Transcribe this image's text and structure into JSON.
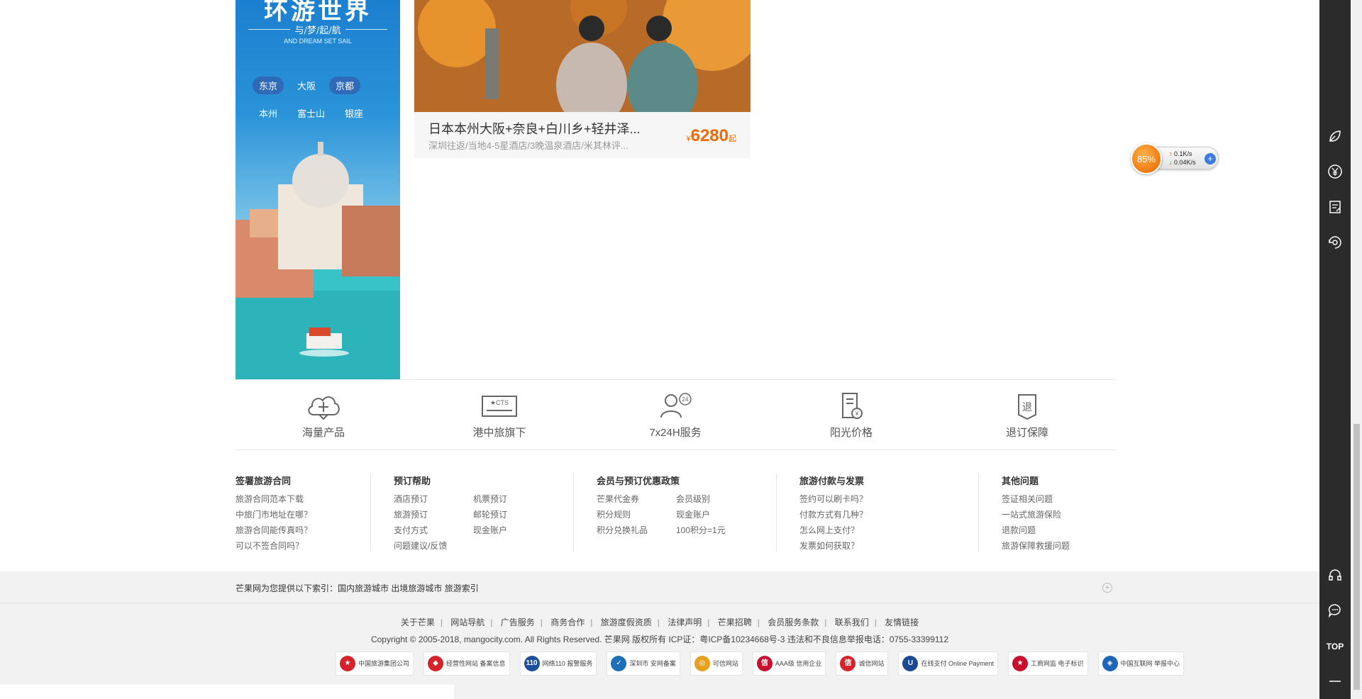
{
  "banner": {
    "title": "环游世界",
    "subtitle": "与/梦/起/航",
    "subtitle_en": "AND DREAM SET SAIL",
    "cities_row1": [
      "东京",
      "大阪",
      "京都"
    ],
    "cities_row2": [
      "本州",
      "富士山",
      "银座"
    ]
  },
  "product": {
    "title": "日本本州大阪+奈良+白川乡+轻井泽...",
    "desc": "深圳往返/当地4-5星酒店/3晚温泉酒店/米其林评...",
    "currency": "¥",
    "price": "6280",
    "price_suffix": "起"
  },
  "services": [
    {
      "label": "海量产品",
      "icon": "cloud-plus-icon"
    },
    {
      "label": "港中旅旗下",
      "icon": "cts-card-icon"
    },
    {
      "label": "7x24H服务",
      "icon": "user-24h-icon"
    },
    {
      "label": "阳光价格",
      "icon": "price-document-icon"
    },
    {
      "label": "退订保障",
      "icon": "refund-shield-icon"
    }
  ],
  "help": {
    "contract": {
      "title": "签署旅游合同",
      "links": [
        "旅游合同范本下载",
        "中旅门市地址在哪？",
        "旅游合同能传真吗？",
        "可以不签合同吗？"
      ]
    },
    "booking": {
      "title": "预订帮助",
      "links": [
        "酒店预订",
        "机票预订",
        "旅游预订",
        "邮轮预订",
        "支付方式",
        "现金账户",
        "问题建议/反馈"
      ]
    },
    "member": {
      "title": "会员与预订优惠政策",
      "links": [
        "芒果代金券",
        "会员级别",
        "积分规则",
        "现金账户",
        "积分兑换礼品",
        "100积分=1元"
      ]
    },
    "payment": {
      "title": "旅游付款与发票",
      "links": [
        "签约可以刷卡吗？",
        "付款方式有几种？",
        "怎么网上支付？",
        "发票如何获取？"
      ]
    },
    "other": {
      "title": "其他问题",
      "links": [
        "签证相关问题",
        "一站式旅游保险",
        "退款问题",
        "旅游保障救援问题"
      ]
    }
  },
  "index_bar": {
    "prefix": "芒果网为您提供以下索引：",
    "links": [
      "国内旅游城市",
      "出境旅游城市",
      "旅游索引"
    ]
  },
  "footer": {
    "links": [
      "关于芒果",
      "网站导航",
      "广告服务",
      "商务合作",
      "旅游度假资质",
      "法律声明",
      "芒果招聘",
      "会员服务条款",
      "联系我们",
      "友情链接"
    ],
    "copyright": "Copyright © 2005-2018, mangocity.com. All Rights Reserved. 芒果网 版权所有 ICP证：粤ICP备10234668号-3 违法和不良信息举报电话：0755-33399112",
    "badges": [
      {
        "text": "中国旅游集团公司",
        "color": "#d4232b"
      },
      {
        "text": "经营性网站 备案信息",
        "color": "#d4232b"
      },
      {
        "text": "网络110 报警服务",
        "color": "#1c4f9c"
      },
      {
        "text": "深圳市 安网备案",
        "color": "#1c6fb8"
      },
      {
        "text": "可信网站",
        "color": "#d4232b"
      },
      {
        "text": "AAA级 信用企业",
        "color": "#c8102e"
      },
      {
        "text": "诚信网站",
        "color": "#d4232b"
      },
      {
        "text": "在线支付 Online Payment",
        "color": "#1b4a93"
      },
      {
        "text": "工商网监 电子标识",
        "color": "#c8102e"
      },
      {
        "text": "中国互联网 举报中心",
        "color": "#1c64b8"
      }
    ]
  },
  "speed_widget": {
    "percent": "85%",
    "up": "0.1K/s",
    "down": "0.04K/s"
  },
  "right_toolbar": {
    "top_label": "TOP"
  }
}
